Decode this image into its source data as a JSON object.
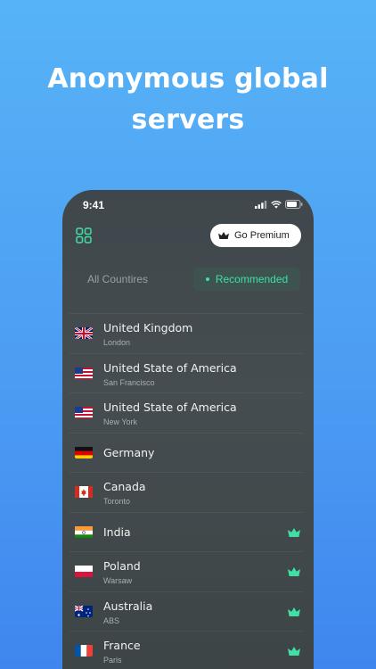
{
  "headline": {
    "line1": "Anonymous global",
    "line2": "servers"
  },
  "status": {
    "time": "9:41"
  },
  "header": {
    "premium_label": "Go Premium"
  },
  "tabs": {
    "all": "All Countires",
    "recommended": "Recommended",
    "selected": "recommended"
  },
  "colors": {
    "accent": "#3ee0a4",
    "background_top": "#57b3f6",
    "background_bottom": "#3f86ee",
    "card": "#41494d"
  },
  "servers": [
    {
      "name": "United Kingdom",
      "city": "London",
      "flag": "uk-flag",
      "premium": false
    },
    {
      "name": "United State of America",
      "city": "San Francisco",
      "flag": "us-flag",
      "premium": false
    },
    {
      "name": "United State of America",
      "city": "New York",
      "flag": "us-flag",
      "premium": false
    },
    {
      "name": "Germany",
      "city": "",
      "flag": "de-flag",
      "premium": false
    },
    {
      "name": "Canada",
      "city": "Toronto",
      "flag": "ca-flag",
      "premium": false
    },
    {
      "name": "India",
      "city": "",
      "flag": "in-flag",
      "premium": true
    },
    {
      "name": "Poland",
      "city": "Warsaw",
      "flag": "pl-flag",
      "premium": true
    },
    {
      "name": "Australia",
      "city": "ABS",
      "flag": "au-flag",
      "premium": true
    },
    {
      "name": "France",
      "city": "Paris",
      "flag": "fr-flag",
      "premium": true
    }
  ]
}
